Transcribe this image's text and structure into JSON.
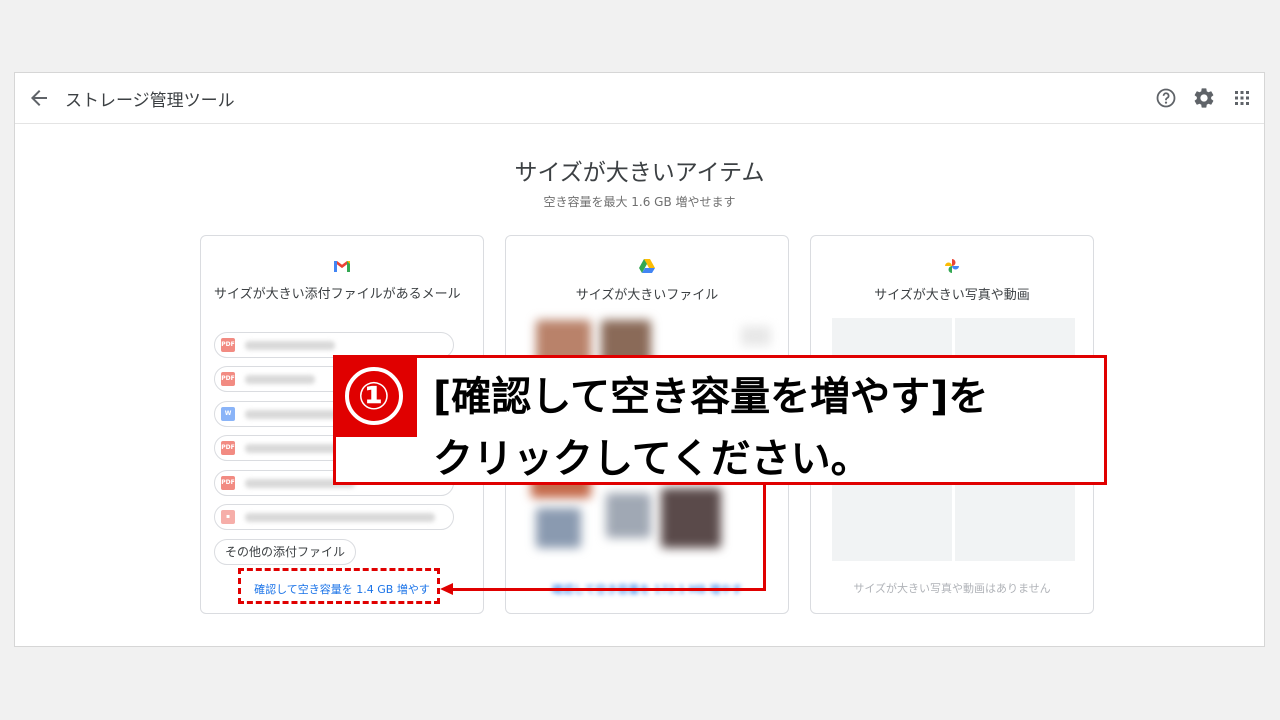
{
  "header": {
    "title": "ストレージ管理ツール",
    "icons": [
      "back-arrow-icon",
      "help-icon",
      "settings-icon",
      "apps-grid-icon"
    ]
  },
  "main": {
    "heading": "サイズが大きいアイテム",
    "subheading": "空き容量を最大 1.6 GB 増やせます"
  },
  "cards": [
    {
      "icon": "gmail-icon",
      "title": "サイズが大きい添付ファイルがあるメール",
      "attachment_types": [
        "PDF",
        "PDF",
        "W",
        "PDF",
        "PDF",
        "image"
      ],
      "other_button": "その他の添付ファイル",
      "link": "確認して空き容量を 1.4 GB 増やす"
    },
    {
      "icon": "google-drive-icon",
      "title": "サイズが大きいファイル",
      "link": "確認して空き容量を 172.1 MB 増やす"
    },
    {
      "icon": "google-photos-icon",
      "title": "サイズが大きい写真や動画",
      "empty_text": "サイズが大きい写真や動画はありません"
    }
  ],
  "annotation": {
    "step_number": "①",
    "line1": "[確認して空き容量を増やす]を",
    "line2": "クリックしてください。"
  },
  "colors": {
    "accent_red": "#e00000",
    "link_blue": "#1a73e8",
    "pdf_red": "#f28b82",
    "doc_blue": "#8ab4f8",
    "image_red": "#f6aea9"
  }
}
